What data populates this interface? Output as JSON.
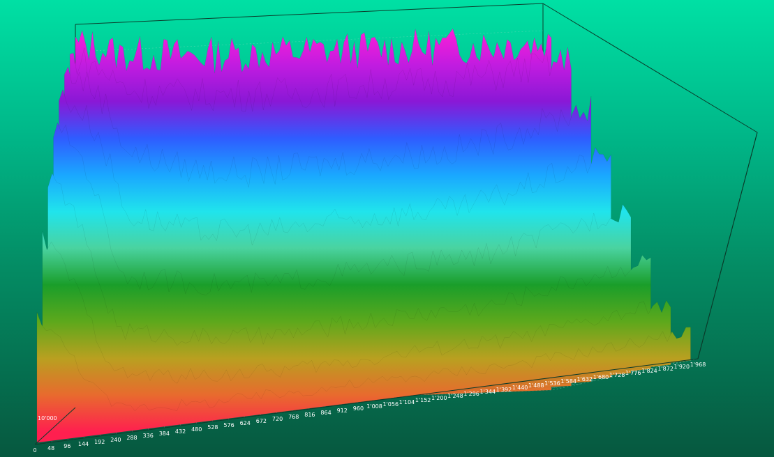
{
  "chart_data": {
    "type": "surface",
    "x_ticks": [
      "0",
      "48",
      "96",
      "144",
      "192",
      "240",
      "288",
      "336",
      "384",
      "432",
      "480",
      "528",
      "576",
      "624",
      "672",
      "720",
      "768",
      "816",
      "864",
      "912",
      "960",
      "1'008",
      "1'056",
      "1'104",
      "1'152",
      "1'200",
      "1'248",
      "1'296",
      "1'344",
      "1'392",
      "1'440",
      "1'488",
      "1'536",
      "1'584",
      "1'632",
      "1'680",
      "1'728",
      "1'776",
      "1'824",
      "1'872",
      "1'920",
      "1'968"
    ],
    "xlim": [
      0,
      1968
    ],
    "z_ticks": [
      "10'000"
    ],
    "grid": true,
    "colormap": [
      "#ff1f4f",
      "#e86a2e",
      "#b9a020",
      "#5da81c",
      "#1a9e2a",
      "#4ad3a0",
      "#20e4ec",
      "#1aa7ff",
      "#2f5cff",
      "#8a18d6",
      "#c21ce0",
      "#ff1fd6"
    ],
    "profile_rows": [
      {
        "x": [
          0,
          48,
          96,
          144,
          192,
          240,
          480,
          720,
          960,
          1200,
          1440,
          1680,
          1968
        ],
        "z": [
          1.0,
          1.0,
          0.99,
          0.98,
          0.97,
          0.97,
          0.96,
          0.96,
          0.96,
          0.96,
          0.96,
          0.96,
          0.96
        ]
      },
      {
        "x": [
          0,
          48,
          96,
          144,
          192,
          240,
          480,
          720,
          960,
          1200,
          1440,
          1680,
          1968
        ],
        "z": [
          0.98,
          0.97,
          0.95,
          0.93,
          0.9,
          0.88,
          0.86,
          0.85,
          0.85,
          0.86,
          0.86,
          0.87,
          0.9
        ]
      },
      {
        "x": [
          0,
          48,
          96,
          144,
          192,
          240,
          480,
          720,
          960,
          1200,
          1440,
          1680,
          1968
        ],
        "z": [
          0.95,
          0.94,
          0.91,
          0.87,
          0.8,
          0.72,
          0.66,
          0.64,
          0.65,
          0.66,
          0.66,
          0.7,
          0.76
        ]
      },
      {
        "x": [
          0,
          48,
          96,
          144,
          192,
          240,
          480,
          720,
          960,
          1200,
          1440,
          1680,
          1968
        ],
        "z": [
          0.9,
          0.88,
          0.84,
          0.78,
          0.68,
          0.56,
          0.5,
          0.48,
          0.49,
          0.5,
          0.5,
          0.55,
          0.62
        ]
      },
      {
        "x": [
          0,
          48,
          96,
          144,
          192,
          240,
          480,
          720,
          960,
          1200,
          1440,
          1680,
          1968
        ],
        "z": [
          0.82,
          0.8,
          0.74,
          0.64,
          0.5,
          0.4,
          0.36,
          0.34,
          0.35,
          0.36,
          0.36,
          0.4,
          0.46
        ]
      },
      {
        "x": [
          0,
          48,
          96,
          144,
          192,
          240,
          480,
          720,
          960,
          1200,
          1440,
          1680,
          1968
        ],
        "z": [
          0.7,
          0.66,
          0.58,
          0.46,
          0.34,
          0.26,
          0.22,
          0.2,
          0.21,
          0.22,
          0.22,
          0.26,
          0.3
        ]
      },
      {
        "x": [
          0,
          48,
          96,
          144,
          192,
          240,
          480,
          720,
          960,
          1200,
          1440,
          1680,
          1968
        ],
        "z": [
          0.55,
          0.5,
          0.42,
          0.32,
          0.22,
          0.15,
          0.12,
          0.11,
          0.11,
          0.12,
          0.12,
          0.14,
          0.17
        ]
      },
      {
        "x": [
          0,
          48,
          96,
          144,
          192,
          240,
          480,
          720,
          960,
          1200,
          1440,
          1680,
          1968
        ],
        "z": [
          0.35,
          0.3,
          0.24,
          0.17,
          0.11,
          0.07,
          0.05,
          0.05,
          0.05,
          0.05,
          0.05,
          0.06,
          0.08
        ]
      }
    ]
  }
}
